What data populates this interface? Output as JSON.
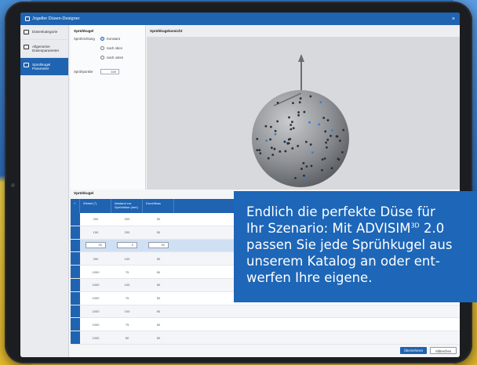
{
  "window": {
    "title": "Jogeller Düsen-Designer"
  },
  "sidebar": {
    "items": [
      {
        "label": "Düsenkategorie",
        "active": false
      },
      {
        "label": "Allgemeine Düsenparameter",
        "active": false
      },
      {
        "label": "Sprühkugel Parameter",
        "active": true
      }
    ]
  },
  "settings": {
    "title": "Sprühkugel",
    "direction_label": "Sprührichtung",
    "options": [
      "Konstant",
      "nach oben",
      "nach unten"
    ],
    "selected_option": "Konstant",
    "count_label": "Sprühpunkte",
    "count_value": "100"
  },
  "viewport": {
    "title": "Sprühkugelansicht"
  },
  "table": {
    "title": "Sprühkugel",
    "headers": [
      "Winkel (°)",
      "Abstand zur Sprühdüse (mm)",
      "Durchfluss"
    ],
    "rows": [
      [
        "200",
        "200",
        "50"
      ],
      [
        "150",
        "200",
        "50"
      ],
      [
        "90",
        "0",
        "50"
      ],
      [
        "200",
        "100",
        "50"
      ],
      [
        "1000",
        "75",
        "50"
      ],
      [
        "1000",
        "100",
        "50"
      ],
      [
        "1000",
        "75",
        "50"
      ],
      [
        "1000",
        "100",
        "50"
      ],
      [
        "1000",
        "75",
        "50"
      ],
      [
        "1000",
        "50",
        "50"
      ]
    ],
    "selected_row": 2
  },
  "buttons": {
    "apply": "Übernehmen",
    "cancel": "Abbrechen"
  },
  "overlay": {
    "line1": "Endlich die perfekte Düse für",
    "line2_pre": "Ihr Szenario: Mit ADVISIM",
    "line2_sup": "3D",
    "line2_post": " 2.0",
    "line3": "passen Sie jede Sprühkugel aus",
    "line4": "unserem Katalog an oder ent-",
    "line5": "werfen Ihre eigene."
  },
  "colors": {
    "accent": "#1f63b1",
    "overlay": "#1d66b8",
    "sphere": "#8f9296"
  }
}
